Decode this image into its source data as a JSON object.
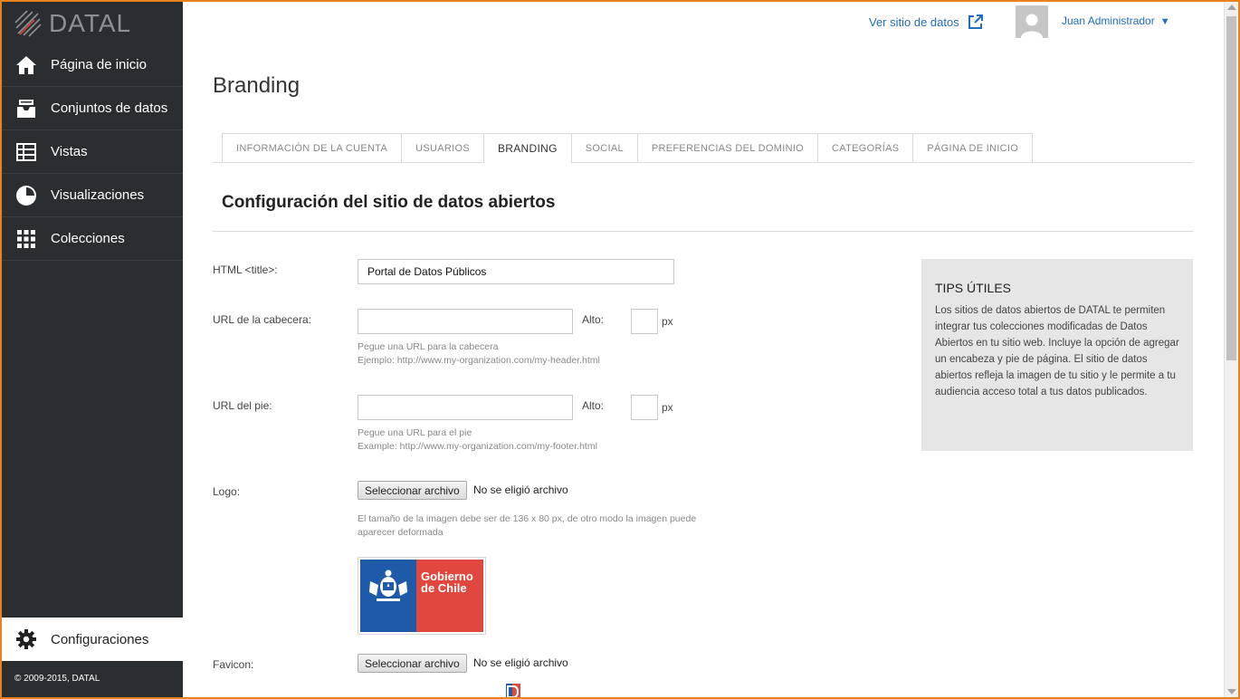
{
  "brand": {
    "name": "DATAL"
  },
  "sidebar": {
    "items": [
      {
        "label": "Página de inicio",
        "icon": "home-icon"
      },
      {
        "label": "Conjuntos de datos",
        "icon": "inbox-icon"
      },
      {
        "label": "Vistas",
        "icon": "table-icon"
      },
      {
        "label": "Visualizaciones",
        "icon": "pie-chart-icon"
      },
      {
        "label": "Colecciones",
        "icon": "grid-icon"
      }
    ],
    "settings_label": "Configuraciones",
    "copyright": "© 2009-2015, DATAL"
  },
  "header": {
    "view_site_label": "Ver sitio de datos",
    "user_name": "Juan Administrador",
    "caret": "▼"
  },
  "page": {
    "title": "Branding",
    "tabs": [
      {
        "label": "INFORMACIÓN DE LA CUENTA"
      },
      {
        "label": "USUARIOS"
      },
      {
        "label": "BRANDING"
      },
      {
        "label": "SOCIAL"
      },
      {
        "label": "PREFERENCIAS DEL DOMINIO"
      },
      {
        "label": "CATEGORÍAS"
      },
      {
        "label": "PÁGINA DE INICIO"
      }
    ],
    "active_tab": "BRANDING",
    "section_title": "Configuración del sitio de datos abiertos"
  },
  "form": {
    "html_title": {
      "label": "HTML <title>:",
      "value": "Portal de Datos Públicos"
    },
    "header_url": {
      "label": "URL de la cabecera:",
      "value": "",
      "height_label": "Alto:",
      "height_value": "",
      "unit": "px",
      "hint_1": "Pegue una URL para la cabecera",
      "hint_2": "Ejemplo: http://www.my-organization.com/my-header.html"
    },
    "footer_url": {
      "label": "URL del pie:",
      "value": "",
      "height_label": "Alto:",
      "height_value": "",
      "unit": "px",
      "hint_1": "Pegue una URL para el pie",
      "hint_2": "Example: http://www.my-organization.com/my-footer.html"
    },
    "logo": {
      "label": "Logo:",
      "button": "Seleccionar archivo",
      "status": "No se eligió archivo",
      "hint_1": "El tamaño de la imagen debe ser de 136 x 80 px, de otro modo la imagen puede",
      "hint_2": "aparecer deformada",
      "preview_text_1": "Gobierno",
      "preview_text_2": "de Chile"
    },
    "favicon": {
      "label": "Favicon:",
      "button": "Seleccionar archivo",
      "status": "No se eligió archivo"
    }
  },
  "tips": {
    "title": "TIPS ÚTILES",
    "body": "Los sitios de datos abiertos de DATAL te permiten integrar tus colecciones modificadas de Datos Abiertos en tu sitio web. Incluye la opción de agregar un encabeza y pie de página. El sitio de datos abiertos refleja la imagen de tu sitio y le permite a tu audiencia acceso total a tus datos publicados."
  },
  "colors": {
    "sidebar_bg": "#2b2e31",
    "link": "#1f6dc2",
    "frame": "#e8821e",
    "tips_bg": "#e6e6e6",
    "logo_blue": "#1e5aa8",
    "logo_red": "#e0473e"
  }
}
